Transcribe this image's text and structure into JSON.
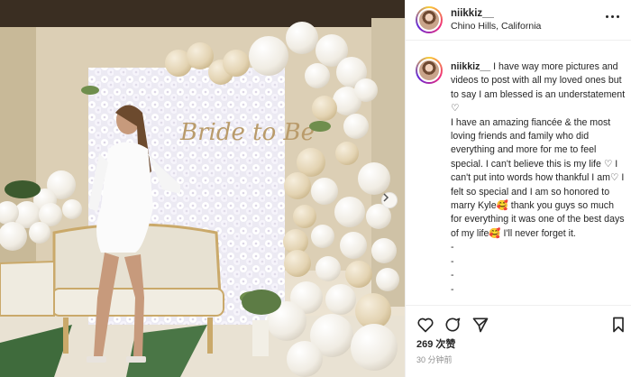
{
  "post": {
    "username": "niikkiz__",
    "location": "Chino Hills, California",
    "photo_sign_text": "Bride to Be",
    "caption_username": "niikkiz__",
    "caption_text": " I have way more pictures and videos to post with all my loved ones but to say I am blessed is an understatement ♡\nI have an amazing fiancée & the most loving friends and family who did everything and more for me to feel special. I can't believe this is my life ♡ I can't put into words how thankful I am♡ I felt so special and I am so honored to marry Kyle🥰 thank you guys so much for everything it was one of the best days of my life🥰 I'll never forget it.\n-\n-\n-\n-\n-",
    "likes_text": "269 次赞",
    "time_text": "30 分钟前"
  },
  "icons": {
    "like": "heart-icon",
    "comment": "comment-icon",
    "share": "paper-plane-icon",
    "save": "bookmark-icon",
    "more": "more-options-icon",
    "carousel_next": "chevron-right-icon"
  },
  "colors": {
    "text": "#262626",
    "muted": "#8e8e8e",
    "border": "#efefef",
    "balloon_white": "#f4f1ea",
    "balloon_cream": "#e8dcc0",
    "sign_gold": "#b99b6b"
  }
}
